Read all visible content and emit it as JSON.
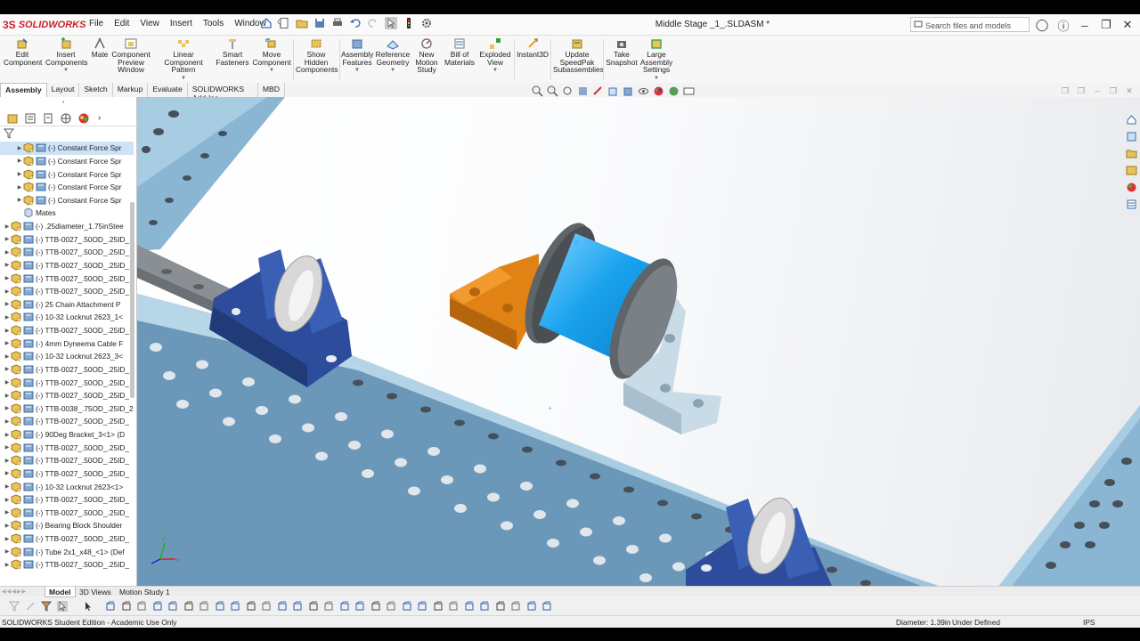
{
  "app": {
    "logo_ds": "3S",
    "logo_name": "SOLIDWORKS",
    "document_title": "Middle Stage _1_.SLDASM *"
  },
  "menu": [
    "File",
    "Edit",
    "View",
    "Insert",
    "Tools",
    "Window"
  ],
  "search": {
    "placeholder": "Search files and models"
  },
  "commands": [
    {
      "label": "Edit Component",
      "icon": "edit-component-icon"
    },
    {
      "label": "Insert Components",
      "icon": "insert-components-icon"
    },
    {
      "label": "Mate",
      "icon": "mate-icon"
    },
    {
      "label": "Component Preview Window",
      "icon": "component-preview-icon"
    },
    {
      "label": "Linear Component Pattern",
      "icon": "linear-pattern-icon"
    },
    {
      "label": "Smart Fasteners",
      "icon": "smart-fasteners-icon"
    },
    {
      "label": "Move Component",
      "icon": "move-component-icon"
    },
    {
      "label": "Show Hidden Components",
      "icon": "show-hidden-icon"
    },
    {
      "label": "Assembly Features",
      "icon": "assembly-features-icon"
    },
    {
      "label": "Reference Geometry",
      "icon": "reference-geometry-icon"
    },
    {
      "label": "New Motion Study",
      "icon": "motion-study-icon"
    },
    {
      "label": "Bill of Materials",
      "icon": "bill-of-materials-icon"
    },
    {
      "label": "Exploded View",
      "icon": "exploded-view-icon"
    },
    {
      "label": "Instant3D",
      "icon": "instant3d-icon"
    },
    {
      "label": "Update SpeedPak Subassemblies",
      "icon": "speedpak-icon"
    },
    {
      "label": "Take Snapshot",
      "icon": "snapshot-icon"
    },
    {
      "label": "Large Assembly Settings",
      "icon": "large-assembly-icon"
    }
  ],
  "tabs": [
    "Assembly",
    "Layout",
    "Sketch",
    "Markup",
    "Evaluate",
    "SOLIDWORKS Add-Ins",
    "MBD"
  ],
  "active_tab": "Assembly",
  "tree": [
    {
      "label": "(-) Constant Force Spr",
      "indent": 2,
      "selected": true
    },
    {
      "label": "(-) Constant Force Spr",
      "indent": 2
    },
    {
      "label": "(-) Constant Force Spr",
      "indent": 2
    },
    {
      "label": "(-) Constant Force Spr",
      "indent": 2
    },
    {
      "label": "(-) Constant Force Spr",
      "indent": 2
    },
    {
      "label": "Mates",
      "indent": 2,
      "type": "mates"
    },
    {
      "label": "(-) .25diameter_1.75inStee",
      "indent": 1
    },
    {
      "label": "(-) TTB-0027_.50OD_.25ID_",
      "indent": 1
    },
    {
      "label": "(-) TTB-0027_.50OD_.25ID_",
      "indent": 1
    },
    {
      "label": "(-) TTB-0027_.50OD_.25ID_",
      "indent": 1
    },
    {
      "label": "(-) TTB-0027_.50OD_.25ID_",
      "indent": 1
    },
    {
      "label": "(-) TTB-0027_.50OD_.25ID_",
      "indent": 1
    },
    {
      "label": "(-) 25 Chain Attachment P",
      "indent": 1
    },
    {
      "label": "(-) 10-32 Locknut 2623_1<",
      "indent": 1
    },
    {
      "label": "(-) TTB-0027_.50OD_.25ID_",
      "indent": 1
    },
    {
      "label": "(-) 4mm Dyneema Cable F",
      "indent": 1
    },
    {
      "label": "(-) 10-32 Locknut 2623_3<",
      "indent": 1
    },
    {
      "label": "(-) TTB-0027_.50OD_.25ID_",
      "indent": 1
    },
    {
      "label": "(-) TTB-0027_.50OD_.25ID_",
      "indent": 1
    },
    {
      "label": "(-) TTB-0027_.50OD_.25ID_",
      "indent": 1
    },
    {
      "label": "(-) TTB-0038_.75OD_.25ID_2",
      "indent": 1
    },
    {
      "label": "(-) TTB-0027_.50OD_.25ID_",
      "indent": 1
    },
    {
      "label": "(-) 90Deg Bracket_3<1> (D",
      "indent": 1
    },
    {
      "label": "(-) TTB-0027_.50OD_.25ID_",
      "indent": 1
    },
    {
      "label": "(-) TTB-0027_.50OD_.25ID_",
      "indent": 1
    },
    {
      "label": "(-) TTB-0027_.50OD_.25ID_",
      "indent": 1
    },
    {
      "label": "(-) 10-32 Locknut 2623<1>",
      "indent": 1
    },
    {
      "label": "(-) TTB-0027_.50OD_.25ID_",
      "indent": 1
    },
    {
      "label": "(-) TTB-0027_.50OD_.25ID_",
      "indent": 1
    },
    {
      "label": "(-) Bearing Block Shoulder",
      "indent": 1
    },
    {
      "label": "(-) TTB-0027_.50OD_.25ID_",
      "indent": 1
    },
    {
      "label": "(-) Tube 2x1_x48_<1> (Def",
      "indent": 1
    },
    {
      "label": "(-) TTB-0027_.50OD_.25ID_",
      "indent": 1
    }
  ],
  "bottom_tabs": [
    "Model",
    "3D Views",
    "Motion Study 1"
  ],
  "status": {
    "left": "SOLIDWORKS Student Edition - Academic Use Only",
    "diameter": "Diameter: 1.39in",
    "state": "Under Defined",
    "units": "IPS"
  },
  "colors": {
    "accent_red": "#d0202a",
    "tube_blue": "#7aa7c7",
    "bearing_block": "#2d4d9c",
    "spring_cyan": "#1aa3ee",
    "bracket_orange": "#e08214",
    "bracket_light": "#c9dbe6",
    "disc_gray": "#5f6468",
    "selection": "#cfe3f7"
  }
}
